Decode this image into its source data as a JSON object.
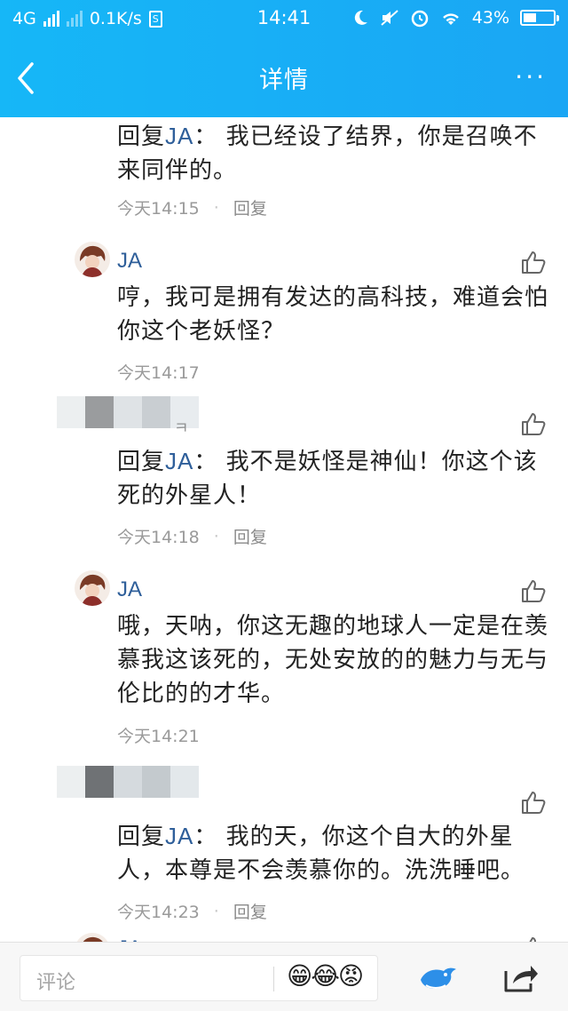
{
  "status_bar": {
    "network": "4G",
    "speed": "0.1K/s",
    "sim_icon_text": "S",
    "time": "14:41",
    "battery_percent": "43%",
    "battery_level": 0.43
  },
  "header": {
    "title": "详情",
    "more": "···"
  },
  "comments": [
    {
      "reply_prefix": "回复",
      "reply_to": "JA",
      "colon": "：",
      "text": "我已经设了结界，你是召唤不来同伴的。",
      "time": "今天14:15",
      "reply_label": "回复"
    },
    {
      "name": "JA",
      "text": "哼，我可是拥有发达的高科技，难道会怕你这个老妖怪？",
      "time": "今天14:17"
    },
    {
      "name_fragment": "\u0001",
      "reply_prefix": "回复",
      "reply_to": "JA",
      "colon": "：",
      "text": "我不是妖怪是神仙！你这个该死的外星人！",
      "time": "今天14:18",
      "reply_label": "回复"
    },
    {
      "name": "JA",
      "text": "哦，天呐，你这无趣的地球人一定是在羡慕我这该死的，无处安放的的魅力与无与伦比的的才华。",
      "time": "今天14:21"
    },
    {
      "reply_prefix": "回复",
      "reply_to": "JA",
      "colon": "：",
      "text": "我的天，你这个自大的外星人，本尊是不会羡慕你的。洗洗睡吧。",
      "time": "今天14:23",
      "reply_label": "回复"
    }
  ],
  "partial_next_name": "JA",
  "bottom_bar": {
    "comment_placeholder": "评论",
    "emojis": "😁😂😡"
  },
  "colors": {
    "header_bg": "#1aa6f4",
    "name_blue": "#2f5f9a",
    "meta_gray": "#9a9a9a"
  }
}
